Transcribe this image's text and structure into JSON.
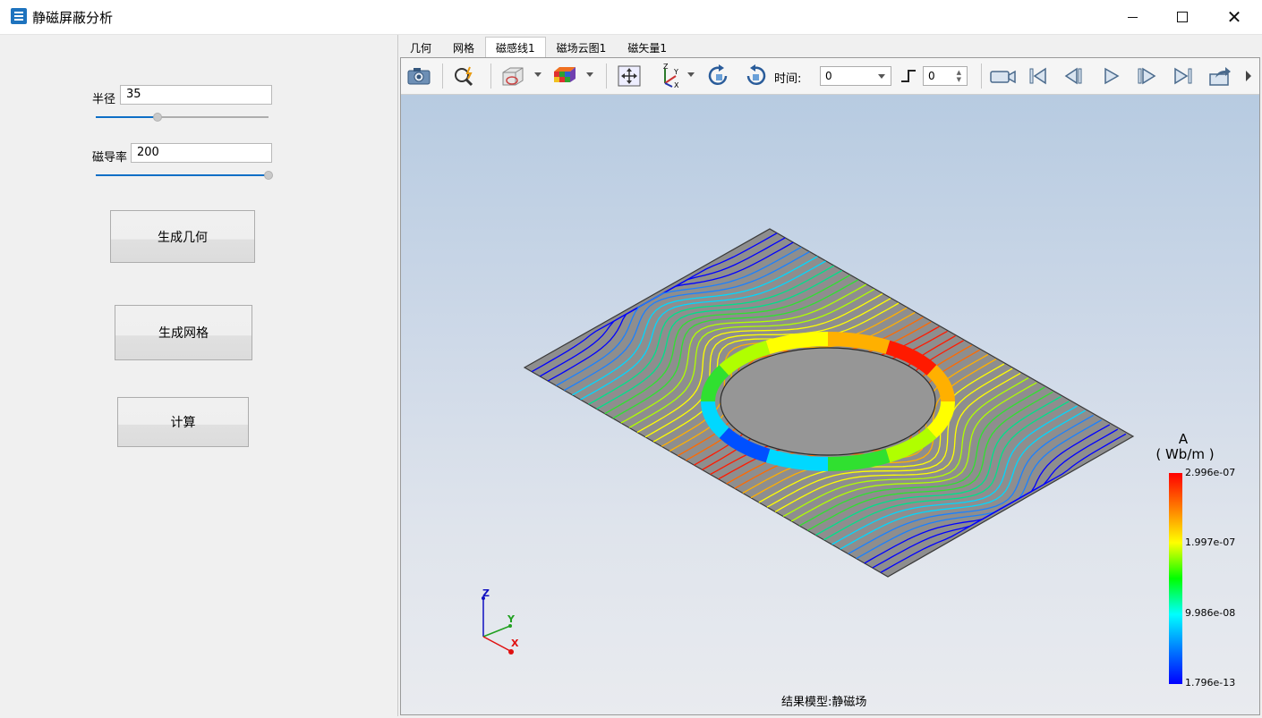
{
  "window": {
    "title": "静磁屏蔽分析",
    "minimize": "—",
    "close": "✕"
  },
  "left_panel": {
    "radius": {
      "label": "半径",
      "value": "35",
      "slider_fraction": 0.36
    },
    "permeability": {
      "label": "磁导率",
      "value": "200",
      "slider_fraction": 1.0
    },
    "buttons": {
      "geometry": "生成几何",
      "mesh": "生成网格",
      "compute": "计算"
    }
  },
  "tabs": [
    "几何",
    "网格",
    "磁感线1",
    "磁场云图1",
    "磁矢量1"
  ],
  "active_tab": "磁感线1",
  "toolbar": {
    "time_label": "时间:",
    "time_value": "0",
    "step_value": "0",
    "icons": [
      "camera-icon",
      "zoom-icon",
      "box-view-icon",
      "color-cube-icon",
      "fit-view-icon",
      "axes-icon",
      "rotate-cw-icon",
      "rotate-ccw-icon",
      "video-camera-icon",
      "first-frame-icon",
      "prev-frame-icon",
      "play-icon",
      "next-frame-icon",
      "last-frame-icon",
      "export-icon"
    ]
  },
  "legend": {
    "title": "A",
    "unit": "( Wb/m )",
    "ticks": [
      "2.996e-07",
      "1.997e-07",
      "9.986e-08",
      "1.796e-13"
    ]
  },
  "triad": {
    "z": "Z",
    "y": "Y",
    "x": "X"
  },
  "footer": "结果模型:静磁场",
  "colors": {
    "accent": "#0e6fc6",
    "plate": "#8e8e8e",
    "background_top": "#b7cbe1",
    "background_bottom": "#e9ebef"
  }
}
